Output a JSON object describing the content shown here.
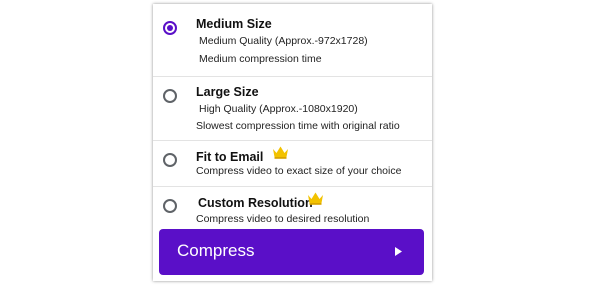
{
  "options": [
    {
      "title": "Medium Size",
      "lines": [
        "Medium Quality   (Approx.-972x1728)",
        "Medium compression time"
      ],
      "selected": true,
      "premium": false
    },
    {
      "title": "Large Size",
      "lines": [
        "High Quality   (Approx.-1080x1920)",
        "Slowest compression time with original ratio"
      ],
      "selected": false,
      "premium": false
    },
    {
      "title": "Fit to Email",
      "lines": [
        "Compress video to exact size of your choice"
      ],
      "selected": false,
      "premium": true
    },
    {
      "title": "Custom Resolution",
      "lines": [
        "Compress video to desired resolution"
      ],
      "selected": false,
      "premium": true
    }
  ],
  "compress_button": {
    "label": "Compress",
    "icon": "play-icon"
  },
  "colors": {
    "accent": "#5a0fc8",
    "crown": "#f2c200",
    "radio_border": "#5f6368"
  },
  "icons": {
    "premium": "crown-icon"
  }
}
